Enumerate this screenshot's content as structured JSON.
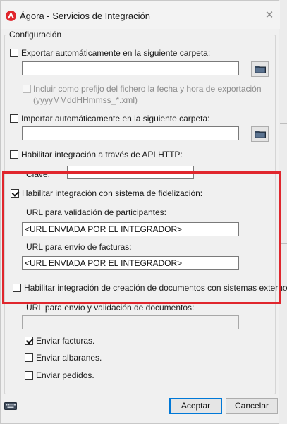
{
  "window": {
    "title": "Ágora - Servicios de Integración",
    "close_symbol": "✕"
  },
  "group": {
    "legend": "Configuración"
  },
  "export": {
    "label": "Exportar automáticamente en la siguiente carpeta:",
    "checked": false,
    "path_value": "",
    "prefix_label": "Incluir como prefijo del fichero la fecha y hora de exportación",
    "prefix_format": "(yyyyMMddHHmmss_*.xml)"
  },
  "import": {
    "label": "Importar automáticamente en la siguiente carpeta:",
    "checked": false,
    "path_value": ""
  },
  "api": {
    "label": "Habilitar integración a través de API HTTP:",
    "checked": false,
    "key_label": "Clave:",
    "key_value": ""
  },
  "loyalty": {
    "label": "Habilitar integración con sistema de fidelización:",
    "checked": true,
    "participants_url_label": "URL para validación de participantes:",
    "participants_url_value": "<URL ENVIADA POR EL INTEGRADOR>",
    "invoices_url_label": "URL para envío de facturas:",
    "invoices_url_value": "<URL ENVIADA POR EL INTEGRADOR>"
  },
  "external_docs": {
    "label": "Habilitar integración de creación de documentos con sistemas externos:",
    "checked": false,
    "url_label": "URL para envío y validación de documentos:",
    "url_value": "",
    "send_invoices_label": "Enviar facturas.",
    "send_invoices_checked": true,
    "send_delivery_notes_label": "Enviar albaranes.",
    "send_delivery_notes_checked": false,
    "send_orders_label": "Enviar pedidos.",
    "send_orders_checked": false
  },
  "footer": {
    "accept_label": "Aceptar",
    "cancel_label": "Cancelar"
  },
  "colors": {
    "highlight": "#e0262d",
    "brand": "#e0262d",
    "default_button_border": "#0078d7"
  },
  "icons": {
    "app": "agora-logo-icon",
    "close": "close-icon",
    "folder": "folder-icon",
    "keyboard": "keyboard-icon"
  }
}
